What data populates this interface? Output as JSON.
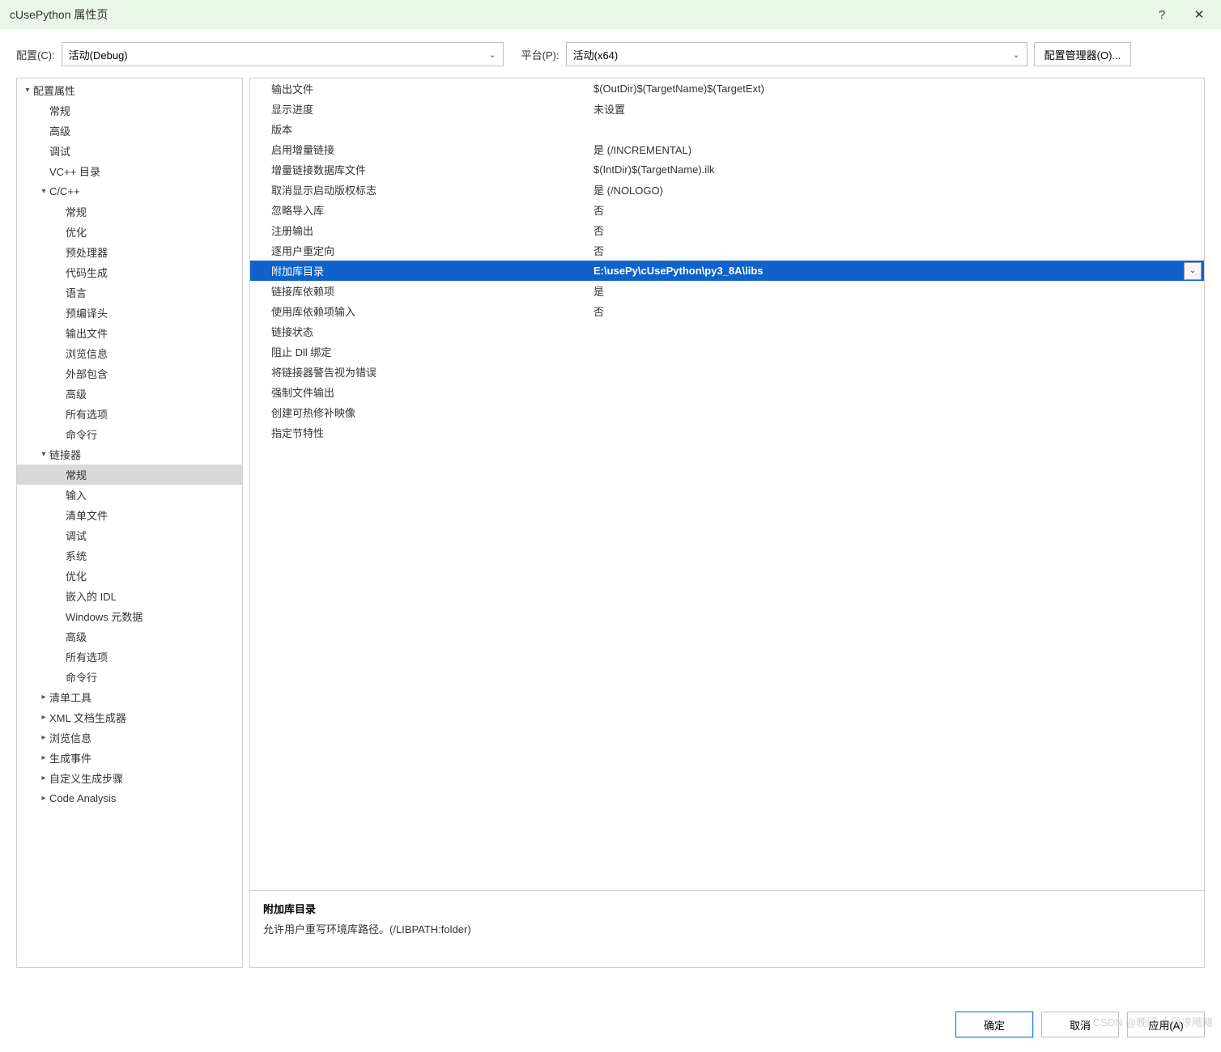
{
  "window": {
    "title": "cUsePython 属性页",
    "help": "?",
    "close": "✕"
  },
  "toolbar": {
    "config_label": "配置(C):",
    "config_value": "活动(Debug)",
    "platform_label": "平台(P):",
    "platform_value": "活动(x64)",
    "config_manager": "配置管理器(O)..."
  },
  "tree": [
    {
      "label": "配置属性",
      "indent": 0,
      "exp": "▾"
    },
    {
      "label": "常规",
      "indent": 1,
      "exp": ""
    },
    {
      "label": "高级",
      "indent": 1,
      "exp": ""
    },
    {
      "label": "调试",
      "indent": 1,
      "exp": ""
    },
    {
      "label": "VC++ 目录",
      "indent": 1,
      "exp": ""
    },
    {
      "label": "C/C++",
      "indent": 1,
      "exp": "▾"
    },
    {
      "label": "常规",
      "indent": 2,
      "exp": ""
    },
    {
      "label": "优化",
      "indent": 2,
      "exp": ""
    },
    {
      "label": "预处理器",
      "indent": 2,
      "exp": ""
    },
    {
      "label": "代码生成",
      "indent": 2,
      "exp": ""
    },
    {
      "label": "语言",
      "indent": 2,
      "exp": ""
    },
    {
      "label": "预编译头",
      "indent": 2,
      "exp": ""
    },
    {
      "label": "输出文件",
      "indent": 2,
      "exp": ""
    },
    {
      "label": "浏览信息",
      "indent": 2,
      "exp": ""
    },
    {
      "label": "外部包含",
      "indent": 2,
      "exp": ""
    },
    {
      "label": "高级",
      "indent": 2,
      "exp": ""
    },
    {
      "label": "所有选项",
      "indent": 2,
      "exp": ""
    },
    {
      "label": "命令行",
      "indent": 2,
      "exp": ""
    },
    {
      "label": "链接器",
      "indent": 1,
      "exp": "▾"
    },
    {
      "label": "常规",
      "indent": 2,
      "exp": "",
      "selected": true
    },
    {
      "label": "输入",
      "indent": 2,
      "exp": ""
    },
    {
      "label": "清单文件",
      "indent": 2,
      "exp": ""
    },
    {
      "label": "调试",
      "indent": 2,
      "exp": ""
    },
    {
      "label": "系统",
      "indent": 2,
      "exp": ""
    },
    {
      "label": "优化",
      "indent": 2,
      "exp": ""
    },
    {
      "label": "嵌入的 IDL",
      "indent": 2,
      "exp": ""
    },
    {
      "label": "Windows 元数据",
      "indent": 2,
      "exp": ""
    },
    {
      "label": "高级",
      "indent": 2,
      "exp": ""
    },
    {
      "label": "所有选项",
      "indent": 2,
      "exp": ""
    },
    {
      "label": "命令行",
      "indent": 2,
      "exp": ""
    },
    {
      "label": "清单工具",
      "indent": 1,
      "exp": "▸"
    },
    {
      "label": "XML 文档生成器",
      "indent": 1,
      "exp": "▸"
    },
    {
      "label": "浏览信息",
      "indent": 1,
      "exp": "▸"
    },
    {
      "label": "生成事件",
      "indent": 1,
      "exp": "▸"
    },
    {
      "label": "自定义生成步骤",
      "indent": 1,
      "exp": "▸"
    },
    {
      "label": "Code Analysis",
      "indent": 1,
      "exp": "▸"
    }
  ],
  "grid": [
    {
      "key": "输出文件",
      "val": "$(OutDir)$(TargetName)$(TargetExt)"
    },
    {
      "key": "显示进度",
      "val": "未设置"
    },
    {
      "key": "版本",
      "val": ""
    },
    {
      "key": "启用增量链接",
      "val": "是 (/INCREMENTAL)"
    },
    {
      "key": "增量链接数据库文件",
      "val": "$(IntDir)$(TargetName).ilk"
    },
    {
      "key": "取消显示启动版权标志",
      "val": "是 (/NOLOGO)"
    },
    {
      "key": "忽略导入库",
      "val": "否"
    },
    {
      "key": "注册输出",
      "val": "否"
    },
    {
      "key": "逐用户重定向",
      "val": "否"
    },
    {
      "key": "附加库目录",
      "val": "E:\\usePy\\cUsePython\\py3_8A\\libs",
      "selected": true,
      "dropdown": true
    },
    {
      "key": "链接库依赖项",
      "val": "是"
    },
    {
      "key": "使用库依赖项输入",
      "val": "否"
    },
    {
      "key": "链接状态",
      "val": ""
    },
    {
      "key": "阻止 Dll 绑定",
      "val": ""
    },
    {
      "key": "将链接器警告视为错误",
      "val": ""
    },
    {
      "key": "强制文件输出",
      "val": ""
    },
    {
      "key": "创建可热修补映像",
      "val": ""
    },
    {
      "key": "指定节特性",
      "val": ""
    }
  ],
  "description": {
    "title": "附加库目录",
    "text": "允许用户重写环境库路径。(/LIBPATH:folder)"
  },
  "footer": {
    "ok": "确定",
    "cancel": "取消",
    "apply": "应用(A)"
  },
  "watermark": "CSDN @晚间 小风凉飕飕"
}
